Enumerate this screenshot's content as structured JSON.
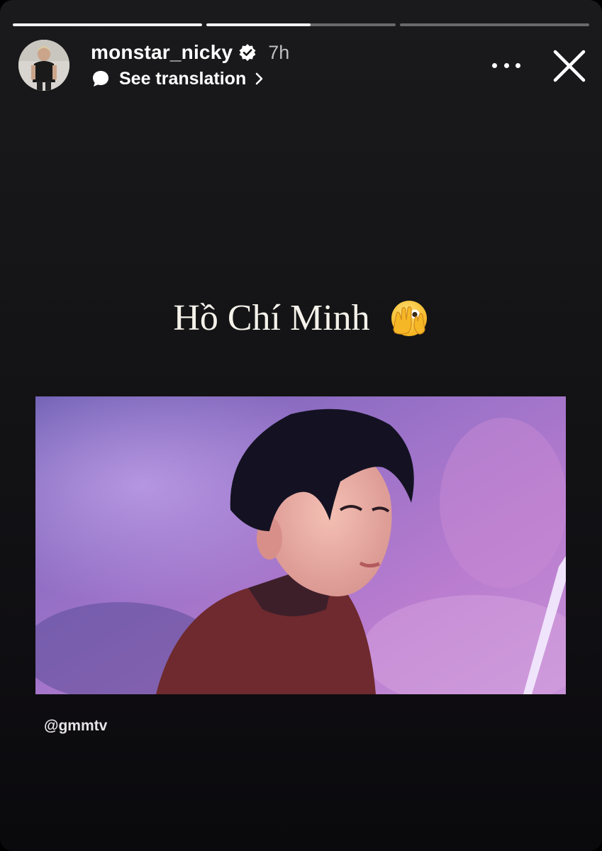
{
  "story": {
    "progress": [
      {
        "fill": 1.0
      },
      {
        "fill": 0.55
      },
      {
        "fill": 0.0
      }
    ]
  },
  "header": {
    "username": "monstar_nicky",
    "time": "7h",
    "translation_label": "See translation",
    "icons": {
      "verified": "verified-badge-icon",
      "translate": "translate-speech-bubble-icon",
      "chevron": "chevron-right-icon",
      "more": "more-options-icon",
      "close": "close-icon"
    }
  },
  "caption": {
    "text": "Hồ Chí Minh",
    "emoji": "face-with-peeking-eye"
  },
  "media": {
    "description_icon": "video-frame"
  },
  "credit": {
    "handle": "@gmmtv"
  },
  "colors": {
    "background": "#141416",
    "text": "#ffffff",
    "media_accent": "#9b74c9"
  }
}
